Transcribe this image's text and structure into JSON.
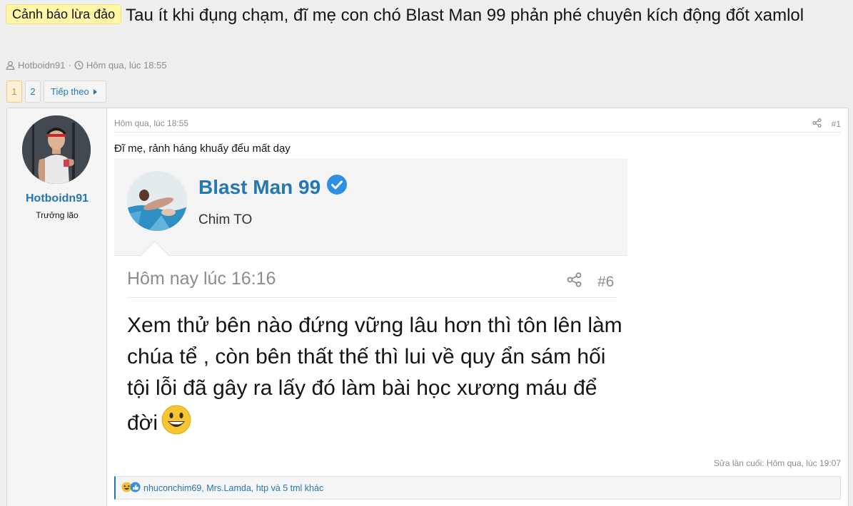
{
  "thread": {
    "prefix": "Cảnh báo lừa đảo",
    "title": "Tau ít khi đụng chạm, đĩ mẹ con chó Blast Man 99 phản phé chuyên kích động đốt xamlol",
    "author": "Hotboidn91",
    "separator": "·",
    "date": "Hôm qua, lúc 18:55"
  },
  "pager": {
    "pages": [
      "1",
      "2"
    ],
    "current": "1",
    "next_label": "Tiếp theo"
  },
  "post": {
    "username": "Hotboidn91",
    "user_title": "Trưởng lão",
    "date": "Hôm qua, lúc 18:55",
    "post_number": "#1",
    "body": "Đĩ mẹ, rảnh háng khuấy đểu mất dạy",
    "last_edit": "Sửa lần cuối: Hôm qua, lúc 19:07",
    "reactions_text": "nhuconchim69, Mrs.Lamda, htp và 5 tml khác"
  },
  "quote_shot": {
    "name": "Blast Man 99",
    "subtitle": "Chim TO",
    "date": "Hôm nay lúc 16:16",
    "post_number": "#6",
    "text": "Xem thử bên nào đứng vững lâu hơn thì tôn lên làm chúa tể , còn bên thất thế thì lui về quy ẩn sám hối tội lỗi đã gây ra lấy đó làm bài học xương máu để đời"
  },
  "colors": {
    "link": "#2577b1",
    "prefix_bg": "#fff6a8",
    "muted": "#8c8c8c"
  },
  "icons": [
    "user-icon",
    "clock-icon",
    "caret-right-icon",
    "share-icon",
    "verified-badge-icon",
    "grin-emoji-icon",
    "laugh-reaction-icon",
    "like-reaction-icon"
  ]
}
